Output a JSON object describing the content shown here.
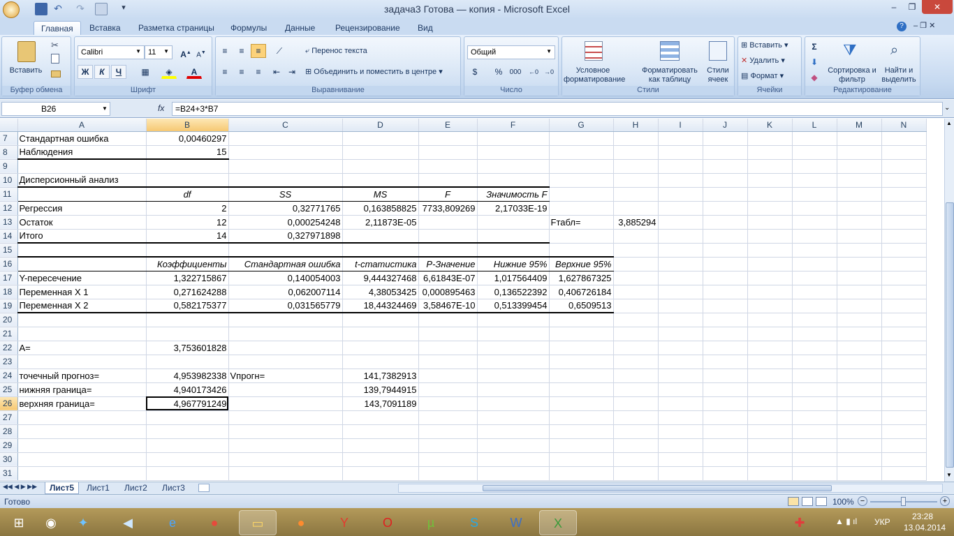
{
  "window": {
    "title": "задача3 Готова — копия - Microsoft Excel"
  },
  "tabs": [
    "Главная",
    "Вставка",
    "Разметка страницы",
    "Формулы",
    "Данные",
    "Рецензирование",
    "Вид"
  ],
  "ribbon": {
    "clipboard": {
      "paste": "Вставить",
      "label": "Буфер обмена"
    },
    "font": {
      "name": "Calibri",
      "size": "11",
      "bold": "Ж",
      "italic": "К",
      "underline": "Ч",
      "label": "Шрифт"
    },
    "alignment": {
      "wrap": "Перенос текста",
      "merge": "Объединить и поместить в центре",
      "label": "Выравнивание"
    },
    "number": {
      "format": "Общий",
      "percent": "%",
      "thousands": "000",
      "label": "Число"
    },
    "styles": {
      "conditional": "Условное форматирование",
      "table": "Форматировать как таблицу",
      "cell": "Стили ячеек",
      "label": "Стили"
    },
    "cells": {
      "insert": "Вставить",
      "delete": "Удалить",
      "format": "Формат",
      "label": "Ячейки"
    },
    "editing": {
      "sort": "Сортировка и фильтр",
      "find": "Найти и выделить",
      "label": "Редактирование"
    }
  },
  "formula_bar": {
    "name_box": "B26",
    "fx": "fx",
    "formula": "=B24+3*B7"
  },
  "columns": [
    "A",
    "B",
    "C",
    "D",
    "E",
    "F",
    "G",
    "H",
    "I",
    "J",
    "K",
    "L",
    "M",
    "N"
  ],
  "rows": [
    {
      "n": "7",
      "cells": [
        "Стандартная ошибка",
        "0,00460297",
        "",
        "",
        "",
        "",
        "",
        "",
        "",
        "",
        "",
        "",
        "",
        ""
      ]
    },
    {
      "n": "8",
      "cells": [
        "Наблюдения",
        "15",
        "",
        "",
        "",
        "",
        "",
        "",
        "",
        "",
        "",
        "",
        "",
        ""
      ]
    },
    {
      "n": "9",
      "cells": [
        "",
        "",
        "",
        "",
        "",
        "",
        "",
        "",
        "",
        "",
        "",
        "",
        "",
        ""
      ]
    },
    {
      "n": "10",
      "cells": [
        "Дисперсионный анализ",
        "",
        "",
        "",
        "",
        "",
        "",
        "",
        "",
        "",
        "",
        "",
        "",
        ""
      ]
    },
    {
      "n": "11",
      "cells": [
        "",
        "df",
        "SS",
        "MS",
        "F",
        "Значимость F",
        "",
        "",
        "",
        "",
        "",
        "",
        "",
        ""
      ]
    },
    {
      "n": "12",
      "cells": [
        "Регрессия",
        "2",
        "0,32771765",
        "0,163858825",
        "7733,809269",
        "2,17033E-19",
        "",
        "",
        "",
        "",
        "",
        "",
        "",
        ""
      ]
    },
    {
      "n": "13",
      "cells": [
        "Остаток",
        "12",
        "0,000254248",
        "2,11873E-05",
        "",
        "",
        "Fтабл=",
        "3,885294",
        "",
        "",
        "",
        "",
        "",
        ""
      ]
    },
    {
      "n": "14",
      "cells": [
        "Итого",
        "14",
        "0,327971898",
        "",
        "",
        "",
        "",
        "",
        "",
        "",
        "",
        "",
        "",
        ""
      ]
    },
    {
      "n": "15",
      "cells": [
        "",
        "",
        "",
        "",
        "",
        "",
        "",
        "",
        "",
        "",
        "",
        "",
        "",
        ""
      ]
    },
    {
      "n": "16",
      "cells": [
        "",
        "Коэффициенты",
        "Стандартная ошибка",
        "t-статистика",
        "P-Значение",
        "Нижние 95%",
        "Верхние 95%",
        "",
        "",
        "",
        "",
        "",
        "",
        ""
      ]
    },
    {
      "n": "17",
      "cells": [
        "Y-пересечение",
        "1,322715867",
        "0,140054003",
        "9,444327468",
        "6,61843E-07",
        "1,017564409",
        "1,627867325",
        "",
        "",
        "",
        "",
        "",
        "",
        ""
      ]
    },
    {
      "n": "18",
      "cells": [
        "Переменная X 1",
        "0,271624288",
        "0,062007114",
        "4,38053425",
        "0,000895463",
        "0,136522392",
        "0,406726184",
        "",
        "",
        "",
        "",
        "",
        "",
        ""
      ]
    },
    {
      "n": "19",
      "cells": [
        "Переменная X 2",
        "0,582175377",
        "0,031565779",
        "18,44324469",
        "3,58467E-10",
        "0,513399454",
        "0,6509513",
        "",
        "",
        "",
        "",
        "",
        "",
        ""
      ]
    },
    {
      "n": "20",
      "cells": [
        "",
        "",
        "",
        "",
        "",
        "",
        "",
        "",
        "",
        "",
        "",
        "",
        "",
        ""
      ]
    },
    {
      "n": "21",
      "cells": [
        "",
        "",
        "",
        "",
        "",
        "",
        "",
        "",
        "",
        "",
        "",
        "",
        "",
        ""
      ]
    },
    {
      "n": "22",
      "cells": [
        "A=",
        "3,753601828",
        "",
        "",
        "",
        "",
        "",
        "",
        "",
        "",
        "",
        "",
        "",
        ""
      ]
    },
    {
      "n": "23",
      "cells": [
        "",
        "",
        "",
        "",
        "",
        "",
        "",
        "",
        "",
        "",
        "",
        "",
        "",
        ""
      ]
    },
    {
      "n": "24",
      "cells": [
        "точечный прогноз=",
        "4,953982338",
        "Vпрогн=",
        "141,7382913",
        "",
        "",
        "",
        "",
        "",
        "",
        "",
        "",
        "",
        ""
      ]
    },
    {
      "n": "25",
      "cells": [
        "нижняя граница=",
        "4,940173426",
        "",
        "139,7944915",
        "",
        "",
        "",
        "",
        "",
        "",
        "",
        "",
        "",
        ""
      ]
    },
    {
      "n": "26",
      "cells": [
        "верхняя граница=",
        "4,967791249",
        "",
        "143,7091189",
        "",
        "",
        "",
        "",
        "",
        "",
        "",
        "",
        "",
        ""
      ]
    },
    {
      "n": "27",
      "cells": [
        "",
        "",
        "",
        "",
        "",
        "",
        "",
        "",
        "",
        "",
        "",
        "",
        "",
        ""
      ]
    },
    {
      "n": "28",
      "cells": [
        "",
        "",
        "",
        "",
        "",
        "",
        "",
        "",
        "",
        "",
        "",
        "",
        "",
        ""
      ]
    },
    {
      "n": "29",
      "cells": [
        "",
        "",
        "",
        "",
        "",
        "",
        "",
        "",
        "",
        "",
        "",
        "",
        "",
        ""
      ]
    },
    {
      "n": "30",
      "cells": [
        "",
        "",
        "",
        "",
        "",
        "",
        "",
        "",
        "",
        "",
        "",
        "",
        "",
        ""
      ]
    },
    {
      "n": "31",
      "cells": [
        "",
        "",
        "",
        "",
        "",
        "",
        "",
        "",
        "",
        "",
        "",
        "",
        "",
        ""
      ]
    }
  ],
  "sheet_tabs": [
    "Лист5",
    "Лист1",
    "Лист2",
    "Лист3"
  ],
  "status": {
    "ready": "Готово",
    "zoom": "100%"
  },
  "taskbar": {
    "lang": "УКР",
    "time": "23:28",
    "date": "13.04.2014"
  }
}
